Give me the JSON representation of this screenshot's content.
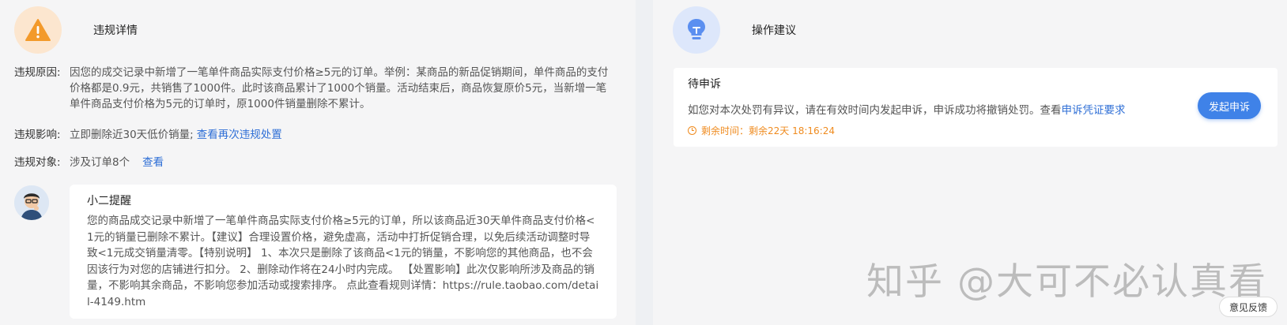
{
  "violation": {
    "title": "违规详情",
    "reason_label": "违规原因:",
    "reason_text": "因您的成交记录中新增了一笔单件商品实际支付价格≥5元的订单。举例：某商品的新品促销期间，单件商品的支付价格都是0.9元，共销售了1000件。此时该商品累计了1000个销量。活动结束后，商品恢复原价5元，当新增一笔单件商品支付价格为5元的订单时，原1000件销量删除不累计。",
    "impact_label": "违规影响:",
    "impact_text": "立即删除近30天低价销量;",
    "impact_link": "查看再次违规处置",
    "target_label": "违规对象:",
    "target_text": "涉及订单8个",
    "target_link": "查看"
  },
  "tip": {
    "title": "小二提醒",
    "body": "您的商品成交记录中新增了一笔单件商品实际支付价格≥5元的订单，所以该商品近30天单件商品支付价格<1元的销量已删除不累计。【建议】合理设置价格，避免虚高，活动中打折促销合理，以免后续活动调整时导致<1元成交销量清零。【特别说明】 1、本次只是删除了该商品<1元的销量，不影响您的其他商品，也不会因该行为对您的店铺进行扣分。 2、删除动作将在24小时内完成。 【处置影响】此次仅影响所涉及商品的销量，不影响其余商品，不影响您参加活动或搜索排序。 点此查看规则详情：https://rule.taobao.com/detail-4149.htm"
  },
  "suggestion": {
    "title": "操作建议",
    "status": "待申诉",
    "desc": "如您对本次处罚有异议，请在有效时间内发起申诉，申诉成功将撤销处罚。查看",
    "desc_link": "申诉凭证要求",
    "remaining": "剩余时间：剩余22天 18:16:24",
    "button": "发起申诉"
  },
  "watermark": "知乎 @大可不必认真看",
  "feedback": "意见反馈",
  "colors": {
    "accent": "#3f82e8",
    "link": "#2f6fd6",
    "warning": "#ef8b1f"
  }
}
